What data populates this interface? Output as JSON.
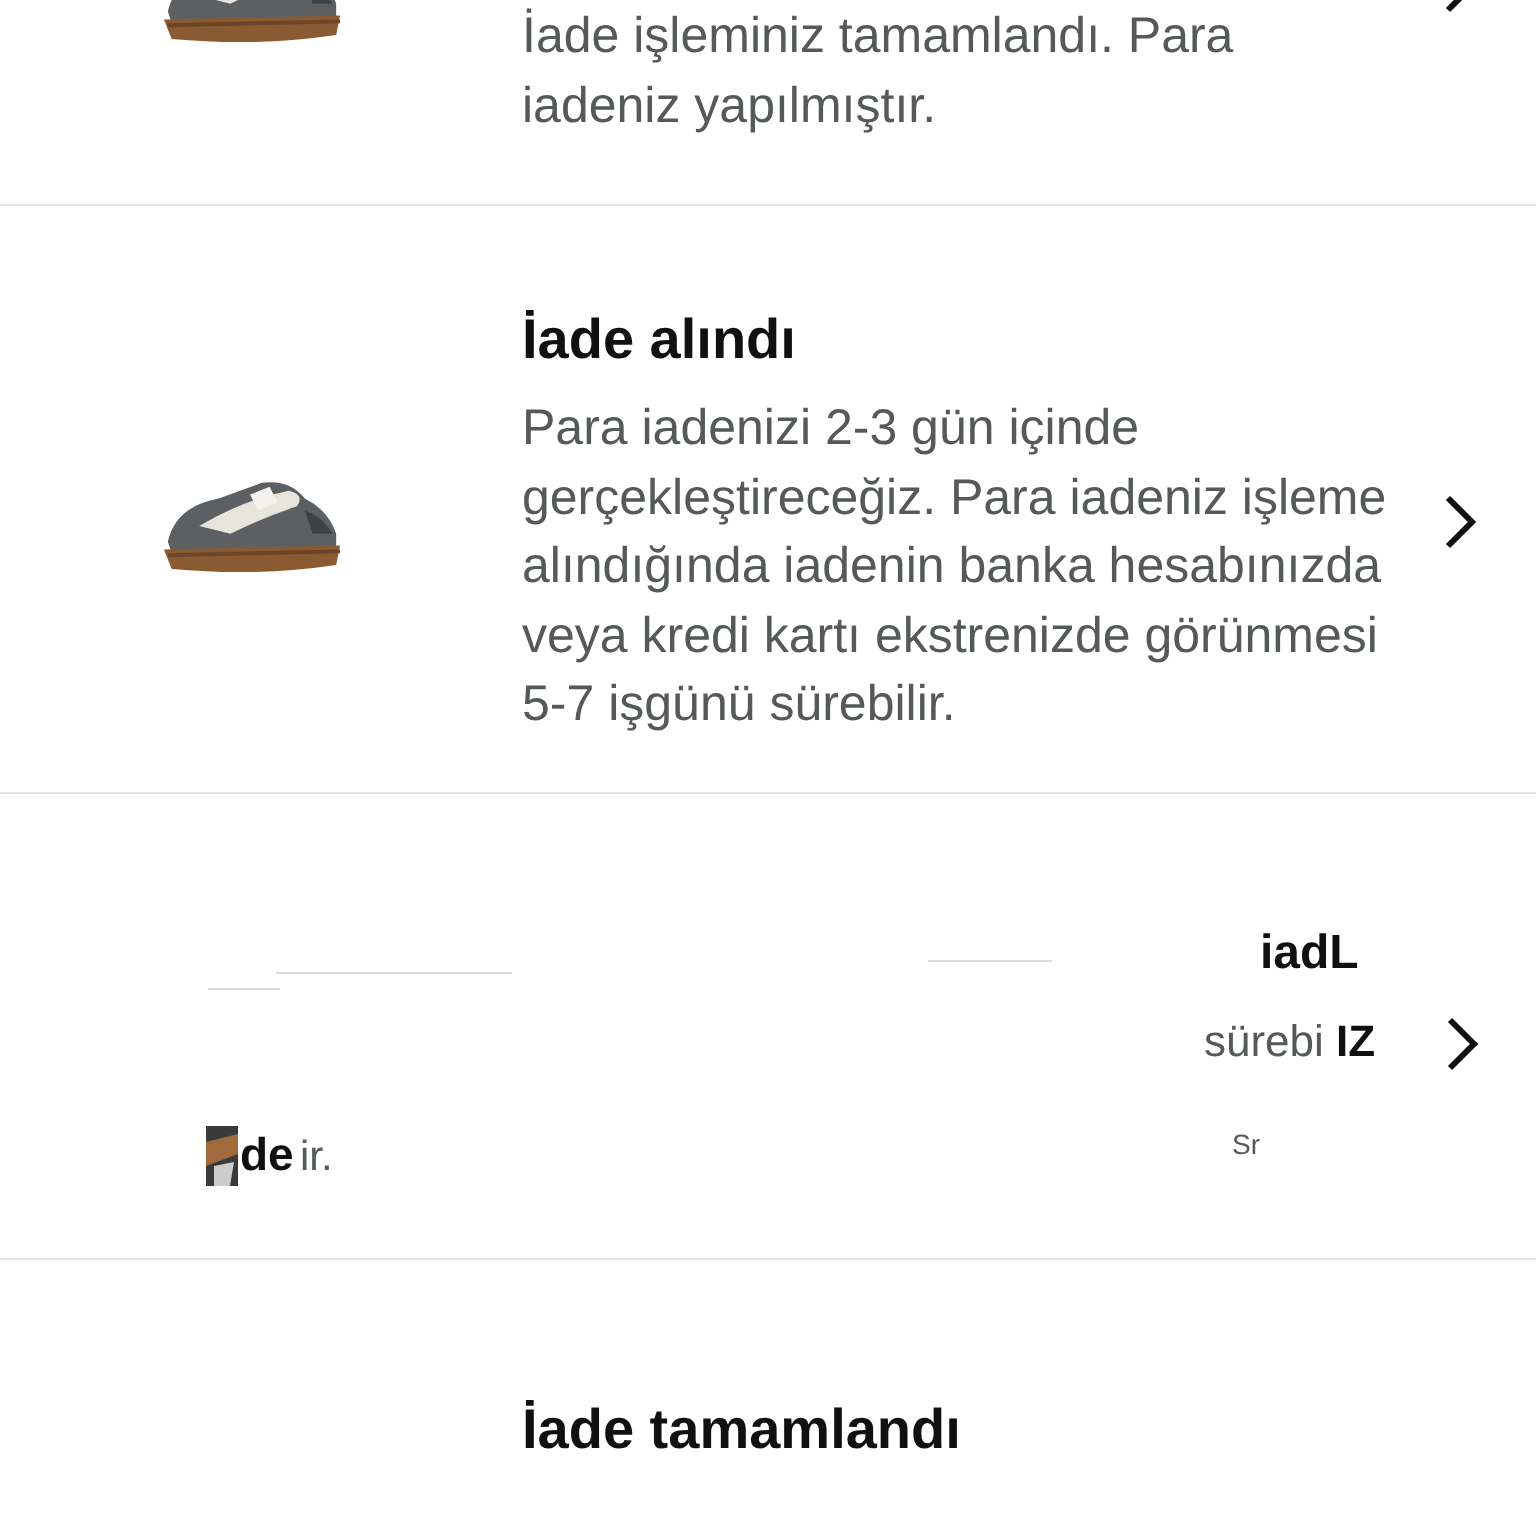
{
  "returns": [
    {
      "kind": "item",
      "body": "İade işleminiz tamamlandı. Para iadeniz yapılmıştır."
    },
    {
      "kind": "item",
      "title": "İade alındı",
      "body": "Para iadenizi 2-3 gün içinde gerçekleştireceğiz. Para iadeniz işleme alındığında iadenin banka hesabınızda veya kredi kartı ekstrenizde görünmesi 5-7 işgünü sürebilir."
    },
    {
      "kind": "glitched",
      "fragments": [
        {
          "text": "iadL",
          "kind": "bold"
        },
        {
          "text": "sürebi",
          "kind": "plain"
        },
        {
          "text": "IZ",
          "kind": "bold"
        },
        {
          "text": "de",
          "kind": "bold"
        },
        {
          "text": "ir.",
          "kind": "plain"
        },
        {
          "text": "Sr",
          "kind": "plain"
        }
      ]
    },
    {
      "kind": "item",
      "title": "İade tamamlandı"
    }
  ]
}
